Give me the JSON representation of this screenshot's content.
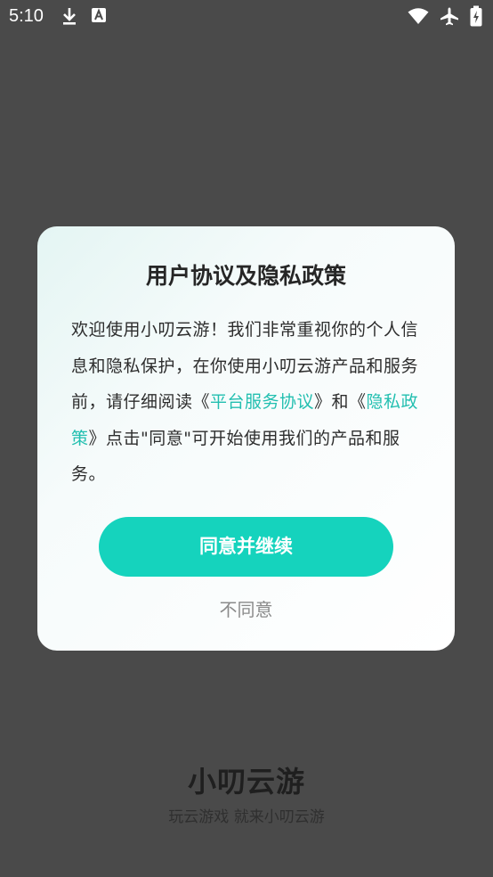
{
  "status_bar": {
    "time": "5:10",
    "icons": [
      "download-icon",
      "a-badge-icon",
      "wifi-icon",
      "airplane-mode-icon",
      "battery-icon"
    ]
  },
  "background_brand": {
    "name": "小叨云游",
    "slogan": "玩云游戏 就来小叨云游"
  },
  "dialog": {
    "title": "用户协议及隐私政策",
    "body_part1": "欢迎使用小叨云游！我们非常重视你的个人信息和隐私保护，在你使用小叨云游产品和服务前，请仔细阅读《",
    "link_service": "平台服务协议",
    "body_part2": "》和《",
    "link_privacy": "隐私政策",
    "body_part3": "》点击\"同意\"可开始使用我们的产品和服务。",
    "agree_button": "同意并继续",
    "disagree_link": "不同意"
  },
  "colors": {
    "overlay": "#4a4a4a",
    "accent": "#15d3bd",
    "link": "#22bfb0"
  }
}
